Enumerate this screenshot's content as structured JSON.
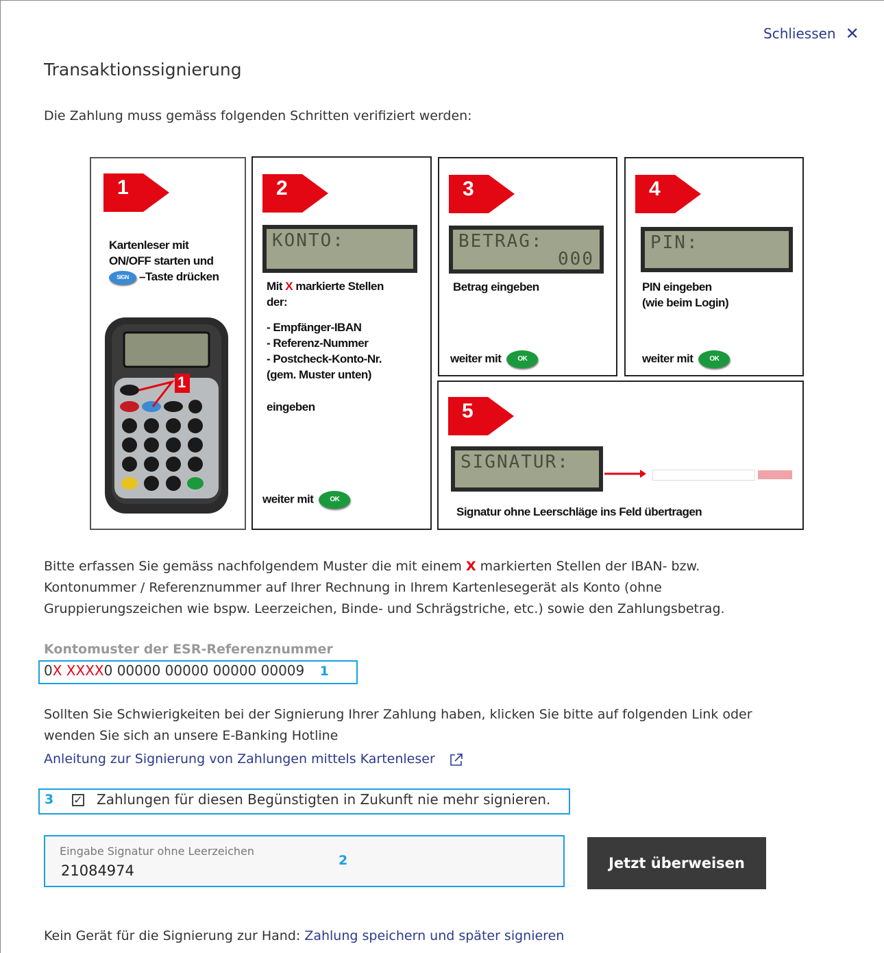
{
  "header": {
    "close_label": "Schliessen",
    "title": "Transaktionssignierung",
    "intro": "Die Zahlung muss gemäss folgenden Schritten verifiziert werden:"
  },
  "steps": {
    "s1": {
      "num": "1",
      "l1": "Kartenleser mit",
      "l2": "ON/OFF starten und",
      "l3": "–Taste drücken",
      "sign_key": "SIGN",
      "marker": "1"
    },
    "s2": {
      "num": "2",
      "lcd": "KONTO:",
      "t1a": "Mit ",
      "x": "X",
      "t1b": " markierte Stellen",
      "t2": "der:",
      "b1": "-    Empfänger-IBAN",
      "b2": "-    Referenz-Nummer",
      "b3": "-    Postcheck-Konto-Nr.",
      "b4": "(gem. Muster unten)",
      "t3": "eingeben",
      "next": "weiter mit",
      "ok": "OK"
    },
    "s3": {
      "num": "3",
      "lcd": "BETRAG:",
      "lcd2": "000",
      "text": "Betrag eingeben",
      "next": "weiter mit",
      "ok": "OK"
    },
    "s4": {
      "num": "4",
      "lcd": "PIN:",
      "t1": "PIN eingeben",
      "t2": "(wie beim Login)",
      "next": "weiter mit",
      "ok": "OK"
    },
    "s5": {
      "num": "5",
      "lcd": "SIGNATUR:",
      "text": "Signatur ohne Leerschläge ins Feld übertragen"
    }
  },
  "instructions": {
    "a": "Bitte erfassen Sie gemäss nachfolgendem Muster die mit einem ",
    "x": "X",
    "b": " markierten Stellen der IBAN- bzw.",
    "line2": "Kontonummer / Referenznummer auf Ihrer Rechnung in Ihrem Kartenlesegerät als Konto (ohne",
    "line3": "Gruppierungszeichen wie bspw. Leerzeichen, Binde- und Schrägstriche, etc.) sowie den Zahlungsbetrag."
  },
  "muster": {
    "label": "Kontomuster der ESR-Referenznummer",
    "p1": "0",
    "p2": "X XXXX",
    "p3": "0 00000 00000 00000 00009",
    "callout": "1"
  },
  "help": {
    "line1": "Sollten Sie Schwierigkeiten bei der Signierung Ihrer Zahlung haben, klicken Sie bitte auf folgenden Link oder",
    "line2": "wenden Sie sich an unsere E-Banking Hotline",
    "link": "Anleitung zur Signierung von Zahlungen mittels Kartenleser"
  },
  "checkbox": {
    "callout": "3",
    "checked": true,
    "label": "Zahlungen für diesen Begünstigten in Zukunft nie mehr signieren."
  },
  "signature": {
    "label": "Eingabe Signatur ohne Leerzeichen",
    "value": "21084974",
    "callout": "2"
  },
  "submit_label": "Jetzt überweisen",
  "footer": {
    "text": "Kein Gerät für die Signierung zur Hand: ",
    "link": "Zahlung speichern und später signieren"
  },
  "colors": {
    "accent_blue": "#1aa0e0",
    "link": "#2b3a8c",
    "red": "#e30613",
    "button": "#3a3a3a"
  }
}
